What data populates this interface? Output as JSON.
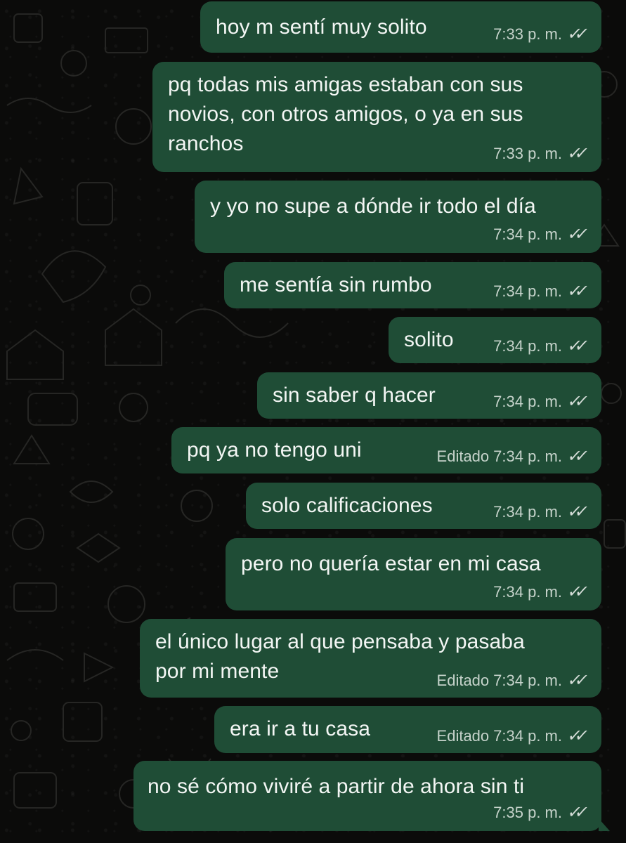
{
  "messages": [
    {
      "text": "hoy m sentí muy solito",
      "edited": "",
      "time": "7:33 p. m.",
      "ticks": "✓✓"
    },
    {
      "text": "pq todas mis amigas estaban con sus novios, con otros amigos, o ya en sus ranchos",
      "lines": [
        "pq todas mis amigas estaban con sus",
        "novios, con otros amigos, o ya en sus",
        "ranchos"
      ],
      "edited": "",
      "time": "7:33 p. m.",
      "ticks": "✓✓"
    },
    {
      "text": "y yo no supe a dónde ir todo el día",
      "edited": "",
      "time": "7:34 p. m.",
      "ticks": "✓✓"
    },
    {
      "text": "me sentía sin rumbo",
      "edited": "",
      "time": "7:34 p. m.",
      "ticks": "✓✓"
    },
    {
      "text": "solito",
      "edited": "",
      "time": "7:34 p. m.",
      "ticks": "✓✓"
    },
    {
      "text": "sin saber q hacer",
      "edited": "",
      "time": "7:34 p. m.",
      "ticks": "✓✓"
    },
    {
      "text": "pq ya no tengo uni",
      "edited": "Editado",
      "time": "7:34 p. m.",
      "ticks": "✓✓"
    },
    {
      "text": "solo calificaciones",
      "edited": "",
      "time": "7:34 p. m.",
      "ticks": "✓✓"
    },
    {
      "text": "pero no quería estar en mi casa",
      "edited": "",
      "time": "7:34 p. m.",
      "ticks": "✓✓"
    },
    {
      "text": "el único lugar al que pensaba y pasaba por mi mente",
      "lines": [
        "el único lugar al que pensaba y pasaba",
        "por mi mente"
      ],
      "edited": "Editado",
      "time": "7:34 p. m.",
      "ticks": "✓✓"
    },
    {
      "text": "era ir a tu casa",
      "edited": "Editado",
      "time": "7:34 p. m.",
      "ticks": "✓✓"
    },
    {
      "text": "no sé cómo viviré a partir de ahora sin ti",
      "edited": "",
      "time": "7:35 p. m.",
      "ticks": "✓✓"
    }
  ],
  "colors": {
    "background": "#0b0b0a",
    "bubble": "#1f4d36",
    "text": "#f3f6f4",
    "meta": "#c6d3cb"
  },
  "icons": [
    "double-check-icon"
  ]
}
